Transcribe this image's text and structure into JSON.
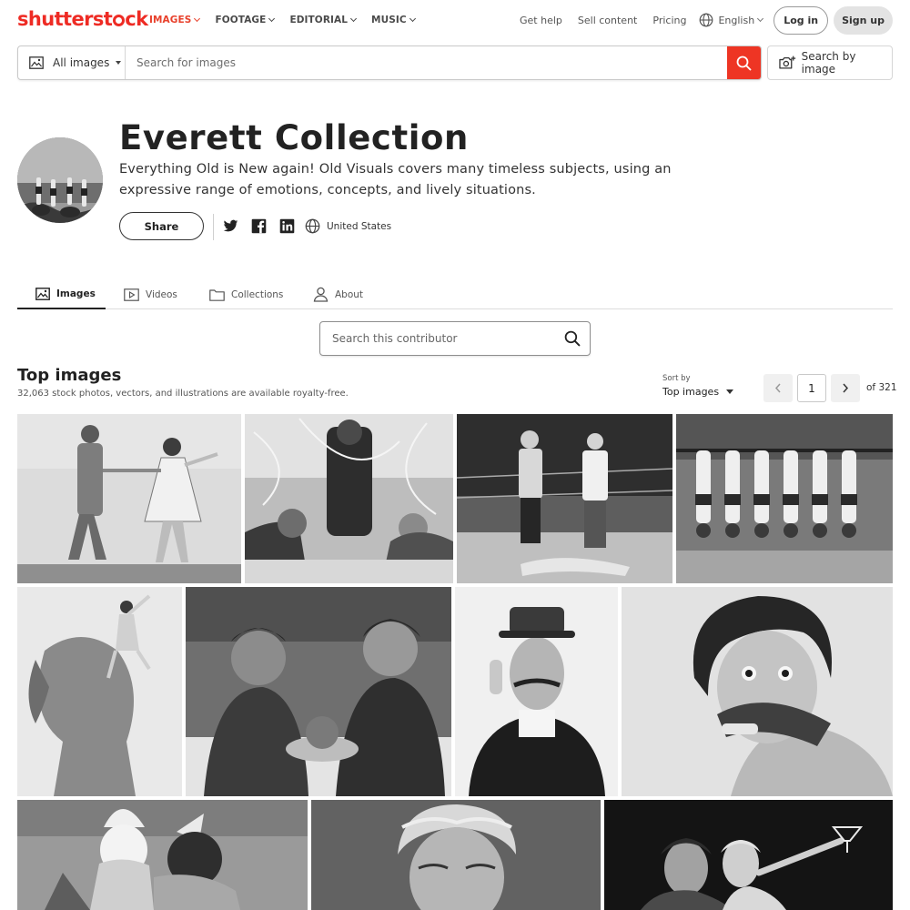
{
  "brand": {
    "logo_text_a": "shutterst",
    "logo_text_b": "ck",
    "color": "#ee2b24"
  },
  "nav": {
    "items": [
      {
        "label": "IMAGES",
        "active": true
      },
      {
        "label": "FOOTAGE",
        "active": false
      },
      {
        "label": "EDITORIAL",
        "active": false
      },
      {
        "label": "MUSIC",
        "active": false
      }
    ],
    "get_help": "Get help",
    "sell_content": "Sell content",
    "pricing": "Pricing",
    "language": "English",
    "login": "Log in",
    "signup": "Sign up"
  },
  "search": {
    "type_label": "All images",
    "placeholder": "Search for images",
    "by_image_label": "Search by image"
  },
  "profile": {
    "name": "Everett Collection",
    "description": "Everything Old is New again! Old Visuals covers many timeless subjects, using an expressive range of emotions, concepts, and lively situations.",
    "share_label": "Share",
    "location": "United States"
  },
  "tabs": [
    {
      "label": "Images",
      "active": true
    },
    {
      "label": "Videos",
      "active": false
    },
    {
      "label": "Collections",
      "active": false
    },
    {
      "label": "About",
      "active": false
    }
  ],
  "contributor_search": {
    "placeholder": "Search this contributor"
  },
  "results": {
    "title": "Top images",
    "subtitle": "32,063 stock photos, vectors, and illustrations are available royalty-free.",
    "sort_label": "Sort by",
    "sort_value": "Top images",
    "page_current": "1",
    "page_total": "of 321"
  },
  "colors": {
    "accent": "#ee3524",
    "text": "#212121"
  }
}
